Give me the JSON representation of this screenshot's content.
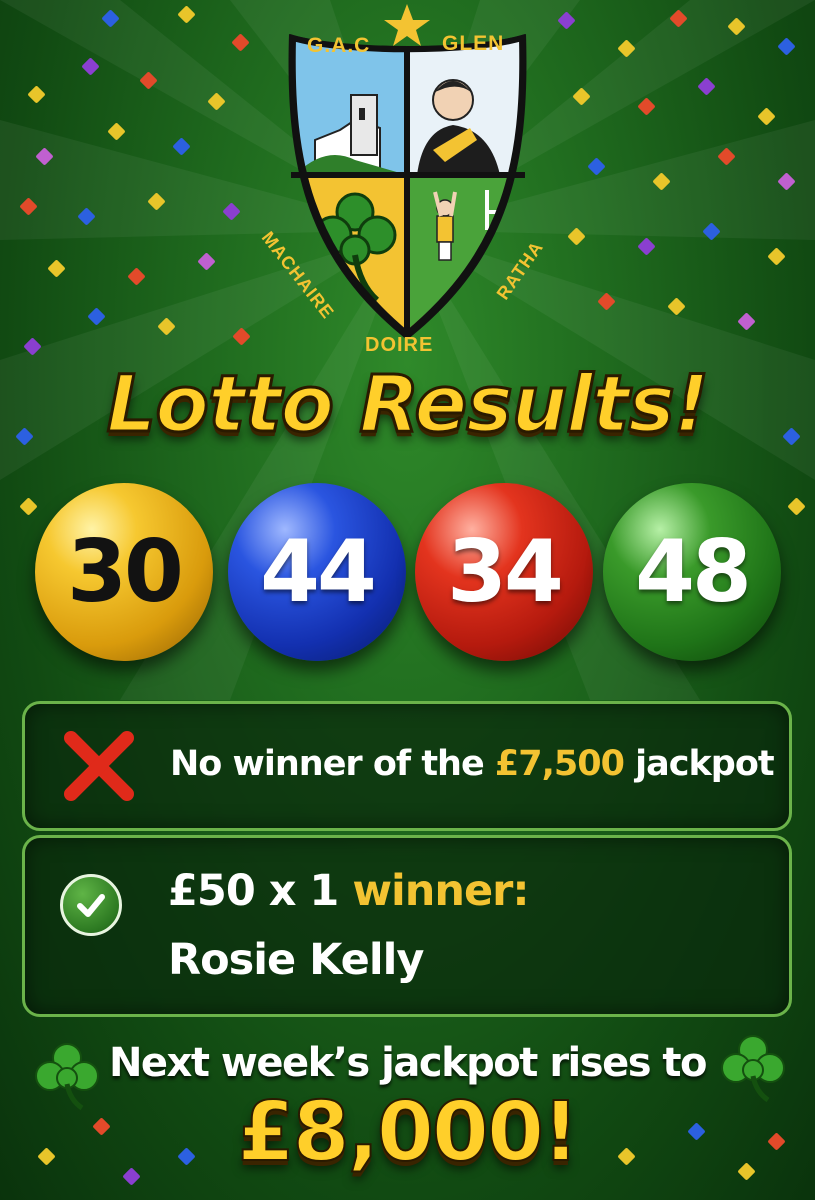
{
  "crest": {
    "top_left": "G.A.C",
    "top_right": "GLEN",
    "left": "MACHAIRE",
    "bottom": "DOIRE",
    "right": "RATHA"
  },
  "title": "Lotto Results!",
  "numbers": [
    "30",
    "44",
    "34",
    "48"
  ],
  "ball_colors": [
    "#f3c332",
    "#1f3fd0",
    "#d02618",
    "#2a8a20"
  ],
  "no_winner": {
    "prefix": "No winner of the ",
    "amount": "£7,500",
    "suffix": " jackpot"
  },
  "winner": {
    "prize": "£50 x 1",
    "label": " winner:",
    "name": "Rosie Kelly"
  },
  "next_week": {
    "text": "Next week’s jackpot rises to",
    "amount": "£8,000!"
  },
  "colors": {
    "background": "#1f6a1e",
    "gold": "#f3c332",
    "panel_border": "#6bb34a",
    "cross": "#e02a1a"
  },
  "icons": [
    "shamrock-icon",
    "cross-icon",
    "check-icon",
    "star-icon"
  ]
}
